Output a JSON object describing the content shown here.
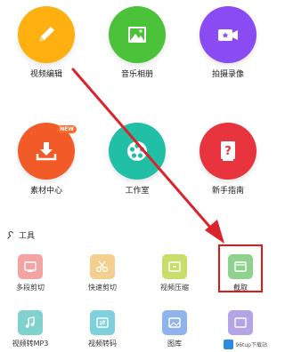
{
  "big_items": [
    {
      "label": "视频编辑",
      "color": "#fdb010",
      "icon": "pencil-icon"
    },
    {
      "label": "音乐相册",
      "color": "#4cc13a",
      "icon": "picture-icon"
    },
    {
      "label": "拍摄录像",
      "color": "#8a4cf2",
      "icon": "video-camera-icon"
    },
    {
      "label": "素材中心",
      "color": "#f25a28",
      "icon": "download-icon",
      "badge": "NEW"
    },
    {
      "label": "工作室",
      "color": "#21bfa6",
      "icon": "film-reel-icon"
    },
    {
      "label": "新手指南",
      "color": "#e8343d",
      "icon": "help-book-icon"
    }
  ],
  "tools": {
    "title": "工具",
    "items": [
      {
        "label": "多段剪切",
        "color": "#f4a3a3",
        "icon": "multi-cut-icon"
      },
      {
        "label": "快速剪切",
        "color": "#f3d08f",
        "icon": "scissors-icon"
      },
      {
        "label": "视频压缩",
        "color": "#c9dd6a",
        "icon": "compress-icon"
      },
      {
        "label": "截取",
        "color": "#8fd28f",
        "icon": "crop-icon"
      },
      {
        "label": "视频转MP3",
        "color": "#80d2cf",
        "icon": "music-note-icon"
      },
      {
        "label": "视频转码",
        "color": "#7fd0dd",
        "icon": "convert-icon"
      },
      {
        "label": "图库",
        "color": "#8fb4ec",
        "icon": "gallery-icon"
      },
      {
        "label": "",
        "color": "#b3a4e6",
        "icon": "more-icon"
      }
    ]
  },
  "watermark": {
    "text": "96tup下载站"
  }
}
